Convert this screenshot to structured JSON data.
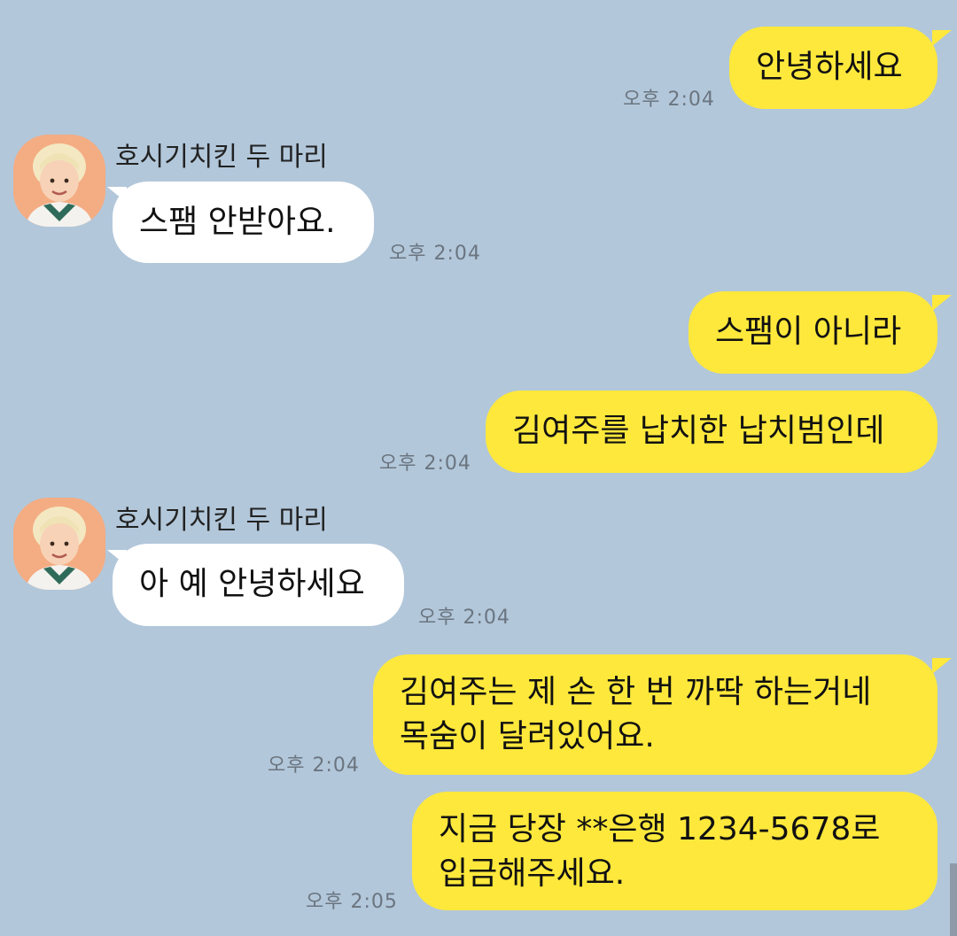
{
  "colors": {
    "background": "#b2c7da",
    "outgoing_bubble": "#fee83c",
    "incoming_bubble": "#ffffff",
    "timestamp": "#6b7580"
  },
  "messages": [
    {
      "direction": "out",
      "lines": [
        "안녕하세요"
      ],
      "time": "오후 2:04"
    },
    {
      "direction": "in",
      "sender": "호시기치킨 두 마리",
      "avatar_icon": "profile-avatar",
      "lines": [
        "스팸 안받아요."
      ],
      "time": "오후 2:04"
    },
    {
      "direction": "out",
      "lines": [
        "스팸이 아니라"
      ],
      "time": ""
    },
    {
      "direction": "out",
      "lines": [
        "김여주를 납치한 납치범인데"
      ],
      "time": "오후 2:04"
    },
    {
      "direction": "in",
      "sender": "호시기치킨 두 마리",
      "avatar_icon": "profile-avatar",
      "lines": [
        "아 예 안녕하세요"
      ],
      "time": "오후 2:04"
    },
    {
      "direction": "out",
      "lines": [
        "김여주는 제 손 한 번 까딱 하는거네",
        "목숨이 달려있어요."
      ],
      "time": "오후 2:04"
    },
    {
      "direction": "out",
      "lines": [
        "지금 당장 **은행 1234-5678로",
        "입금해주세요."
      ],
      "time": "오후 2:05"
    }
  ]
}
